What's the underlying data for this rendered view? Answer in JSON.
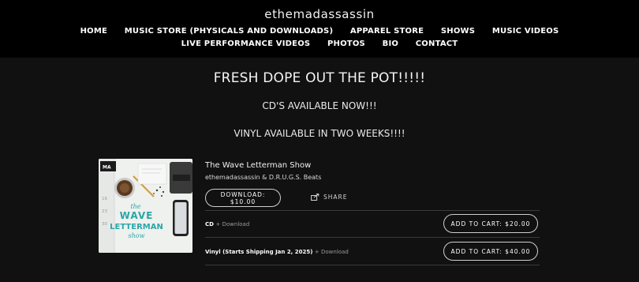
{
  "site": {
    "title": "ethemadassassin"
  },
  "nav": {
    "row1": [
      "HOME",
      "MUSIC STORE (PHYSICALS AND DOWNLOADS)",
      "APPAREL STORE",
      "SHOWS",
      "MUSIC VIDEOS"
    ],
    "row2": [
      "LIVE PERFORMANCE VIDEOS",
      "PHOTOS",
      "BIO",
      "CONTACT"
    ]
  },
  "hero": {
    "headline": "FRESH DOPE OUT THE POT!!!!!",
    "line1": "CD'S AVAILABLE NOW!!!",
    "line2": "VINYL AVAILABLE IN TWO WEEKS!!!!"
  },
  "product": {
    "title": "The Wave Letterman Show",
    "artist": "ethemadassassin & D.R.U.G.S. Beats",
    "download_label": "DOWNLOAD: $10.00",
    "share_label": "SHARE",
    "cover_text": {
      "line1": "the",
      "line2": "WAVE",
      "line3": "LETTERMAN",
      "line4": "show",
      "badge": "MA"
    },
    "variants": [
      {
        "name": "CD",
        "extra": "+ Download",
        "cart_label": "ADD TO CART: $20.00"
      },
      {
        "name": "Vinyl (Starts Shipping Jan 2, 2025)",
        "extra": "+ Download",
        "cart_label": "ADD TO CART: $40.00"
      }
    ]
  },
  "colors": {
    "background": "#111111",
    "header": "#000000",
    "text": "#ececec",
    "cover_teal": "#2aa6a8"
  }
}
